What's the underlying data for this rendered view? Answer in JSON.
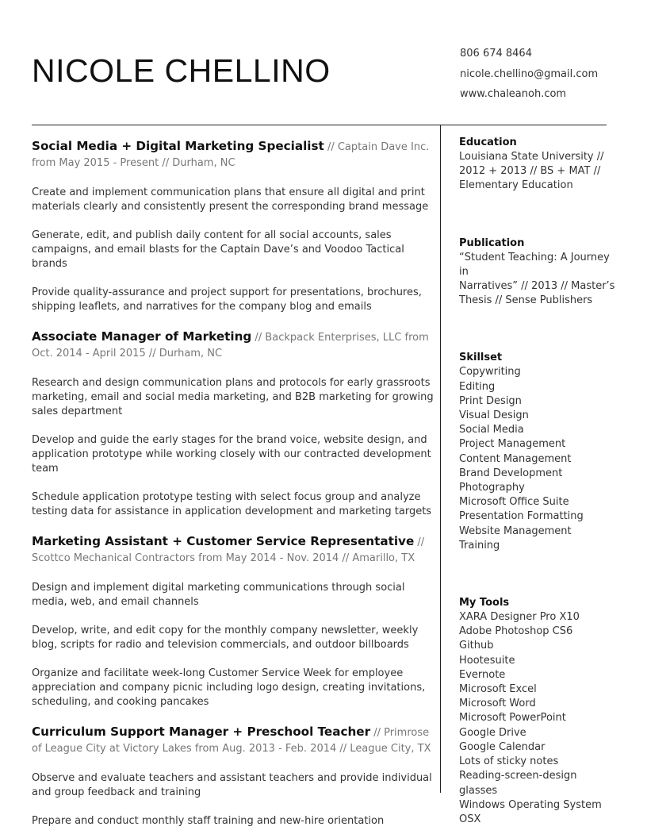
{
  "header": {
    "name": "NICOLE CHELLINO",
    "phone": "806 674 8464",
    "email": "nicole.chellino@gmail.com",
    "website": "www.chaleanoh.com"
  },
  "jobs": [
    {
      "title": "Social Media + Digital Marketing Specialist",
      "meta": " // Captain Dave Inc. from May 2015 - Present // Durham, NC",
      "bullets": [
        "Create and implement communication plans that ensure all digital and print materials clearly and consistently present the corresponding brand message",
        "Generate, edit, and publish daily content for all social accounts, sales campaigns, and email blasts for the Captain Dave’s and Voodoo Tactical brands",
        "Provide quality-assurance and project support for presentations, brochures, shipping leaflets, and narratives for the company blog and emails"
      ]
    },
    {
      "title": "Associate Manager of Marketing",
      "meta": " // Backpack Enterprises, LLC from Oct. 2014 - April 2015 // Durham, NC",
      "bullets": [
        "Research and design communication plans and protocols for early grassroots marketing, email and social media marketing, and B2B marketing for growing sales department",
        "Develop and guide the early stages for the brand voice, website design, and application prototype while working closely with our contracted development team",
        "Schedule application prototype testing with select focus group and analyze testing data for assistance in application development and marketing targets"
      ]
    },
    {
      "title": "Marketing Assistant + Customer Service Representative",
      "meta": " // Scottco Mechanical Contractors from May 2014 - Nov. 2014 // Amarillo, TX",
      "bullets": [
        "Design and implement digital marketing communications through social media, web, and email channels",
        "Develop, write, and edit copy for the monthly company newsletter, weekly blog, scripts for radio and television commercials, and outdoor billboards",
        "Organize and facilitate week-long Customer Service Week for employee appreciation and company picnic including logo design, creating invitations, scheduling, and cooking pancakes"
      ]
    },
    {
      "title": "Curriculum Support Manager + Preschool Teacher",
      "meta": " // Primrose of League City at Victory Lakes from Aug. 2013 - Feb. 2014 // League City, TX",
      "bullets": [
        "Observe and evaluate teachers and assistant teachers and provide individual and group feedback and training",
        "Prepare and conduct monthly staff training and new-hire orientation"
      ]
    }
  ],
  "education": {
    "title": "Education",
    "lines": [
      "Louisiana State University //",
      "2012 + 2013 // BS + MAT //",
      "Elementary Education"
    ]
  },
  "publication": {
    "title": "Publication",
    "lines": [
      "“Student Teaching: A Journey in",
      "Narratives” // 2013 // Master’s",
      "Thesis // Sense Publishers"
    ]
  },
  "skillset": {
    "title": "Skillset",
    "items": [
      "Copywriting",
      "Editing",
      "Print Design",
      "Visual Design",
      "Social Media",
      "Project Management",
      "Content Management",
      "Brand Development",
      "Photography",
      "Microsoft Office Suite",
      "Presentation Formatting",
      "Website Management",
      "Training"
    ]
  },
  "tools": {
    "title": "My Tools",
    "items": [
      "XARA Designer Pro X10",
      "Adobe Photoshop CS6",
      "Github",
      "Hootesuite",
      "Evernote",
      "Microsoft Excel",
      "Microsoft Word",
      "Microsoft PowerPoint",
      "Google Drive",
      "Google Calendar",
      "Lots of sticky notes",
      "Reading-screen-design glasses",
      "Windows Operating System",
      "OSX"
    ]
  }
}
